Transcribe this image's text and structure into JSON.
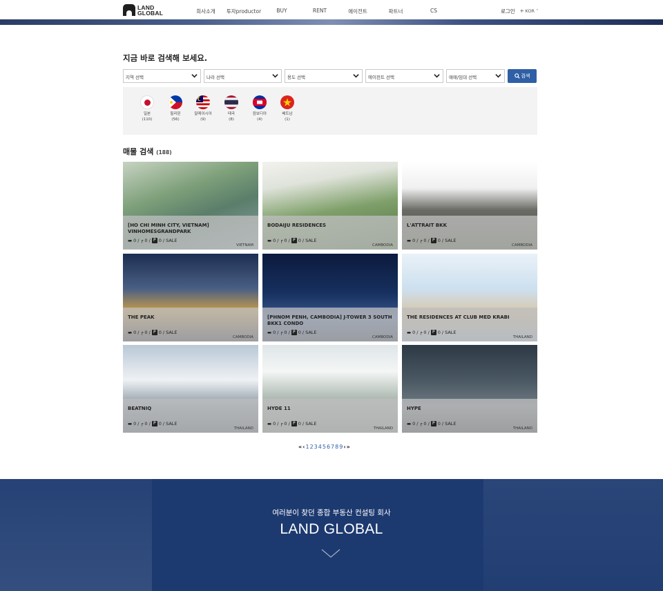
{
  "header": {
    "logo_line1": "LAND",
    "logo_line2": "GLOBAL",
    "nav": [
      "회사소개",
      "투자productor",
      "BUY",
      "RENT",
      "에이전트",
      "파트너",
      "CS"
    ],
    "login": "로그인",
    "language": "KOR"
  },
  "search": {
    "title": "지금 바로 검색해 보세요.",
    "selects": [
      "지역 선택",
      "나라 선택",
      "용도 선택",
      "에이전트 선택",
      "매매/임대 선택"
    ],
    "button_label": "검색"
  },
  "countries": [
    {
      "name": "일본",
      "count": "(110)",
      "flag": "japan"
    },
    {
      "name": "필리핀",
      "count": "(56)",
      "flag": "philippines"
    },
    {
      "name": "말레이시아",
      "count": "(9)",
      "flag": "malaysia"
    },
    {
      "name": "태국",
      "count": "(8)",
      "flag": "thailand"
    },
    {
      "name": "캄보디아",
      "count": "(4)",
      "flag": "cambodia"
    },
    {
      "name": "베트남",
      "count": "(1)",
      "flag": "vietnam"
    }
  ],
  "listings": {
    "title": "매물 검색",
    "count": "(188)",
    "items": [
      {
        "name": "[HO CHI MINH CITY, VIETNAM] VINHOMESGRANDPARK",
        "beds": "0",
        "baths": "0",
        "parking": "0",
        "type": "SALE",
        "country": "VIETNAM"
      },
      {
        "name": "BODAIJU RESIDENCES",
        "beds": "0",
        "baths": "0",
        "parking": "0",
        "type": "SALE",
        "country": "CAMBODIA"
      },
      {
        "name": "L'ATTRAIT BKK",
        "beds": "0",
        "baths": "0",
        "parking": "0",
        "type": "SALE",
        "country": "CAMBODIA"
      },
      {
        "name": "THE PEAK",
        "beds": "0",
        "baths": "0",
        "parking": "0",
        "type": "SALE",
        "country": "CAMBODIA"
      },
      {
        "name": "[PHNOM PENH, CAMBODIA] J-TOWER 3 SOUTH BKK1 CONDO",
        "beds": "0",
        "baths": "0",
        "parking": "0",
        "type": "SALE",
        "country": "CAMBODIA"
      },
      {
        "name": "THE RESIDENCES AT CLUB MED KRABI",
        "beds": "0",
        "baths": "0",
        "parking": "0",
        "type": "SALE",
        "country": "THAILAND"
      },
      {
        "name": "BEATNIQ",
        "beds": "0",
        "baths": "0",
        "parking": "0",
        "type": "SALE",
        "country": "THAILAND"
      },
      {
        "name": "HYDE 11",
        "beds": "0",
        "baths": "0",
        "parking": "0",
        "type": "SALE",
        "country": "THAILAND"
      },
      {
        "name": "HYPE",
        "beds": "0",
        "baths": "0",
        "parking": "0",
        "type": "SALE",
        "country": "THAILAND"
      }
    ]
  },
  "pagination": {
    "first": "«",
    "prev": "‹",
    "pages": [
      "1",
      "2",
      "3",
      "4",
      "5",
      "6",
      "7",
      "8",
      "9"
    ],
    "next": "›",
    "last": "»"
  },
  "footer": {
    "tagline": "여러분이 찾던 종합 부동산 컨설팅 회사",
    "brand": "LAND GLOBAL"
  },
  "colors": {
    "accent": "#2f5fa5",
    "footer_bg": "#1d3a70",
    "flags_bg": "#f3f3f3"
  }
}
